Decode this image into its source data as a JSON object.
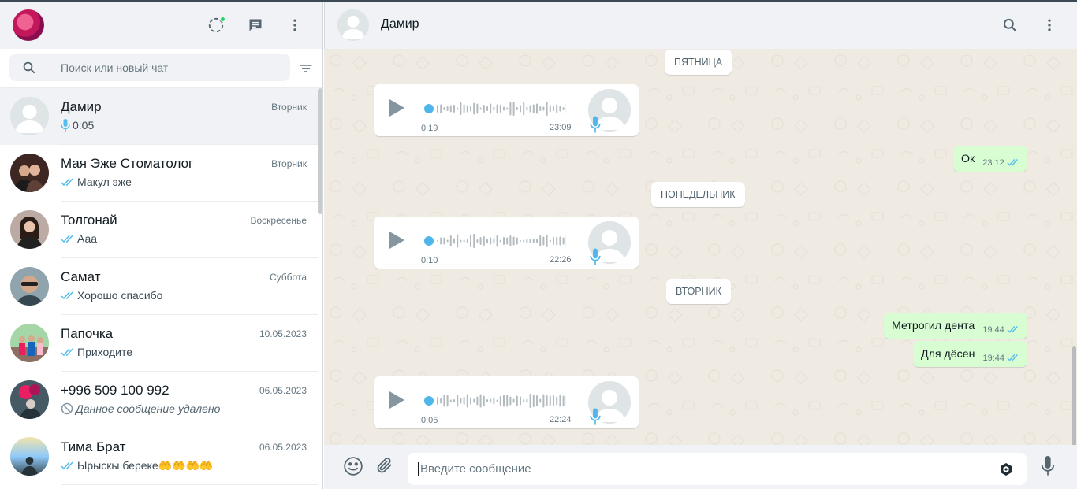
{
  "left_header": {
    "icons": [
      "status-icon",
      "new-chat-icon",
      "menu-icon"
    ]
  },
  "search": {
    "placeholder": "Поиск или новый чат"
  },
  "chats": [
    {
      "name": "Дамир",
      "time": "Вторник",
      "preview": "0:05",
      "preview_type": "voice",
      "active": true
    },
    {
      "name": "Мая Эже Стоматолог",
      "time": "Вторник",
      "preview": "Макул эже",
      "preview_type": "read"
    },
    {
      "name": "Толгонай",
      "time": "Воскресенье",
      "preview": "Ааа",
      "preview_type": "read"
    },
    {
      "name": "Самат",
      "time": "Суббота",
      "preview": "Хорошо спасибо",
      "preview_type": "read"
    },
    {
      "name": "Папочка",
      "time": "10.05.2023",
      "preview": "Приходите",
      "preview_type": "read"
    },
    {
      "name": "+996 509 100 992",
      "time": "06.05.2023",
      "preview": "Данное сообщение удалено",
      "preview_type": "deleted"
    },
    {
      "name": "Тима Брат",
      "time": "06.05.2023",
      "preview": "Ырыскы береке🤲🤲🤲🤲",
      "preview_type": "read"
    }
  ],
  "conversation": {
    "title": "Дамир",
    "dates": [
      "ПЯТНИЦА",
      "ПОНЕДЕЛЬНИК",
      "ВТОРНИК"
    ],
    "voice_messages": [
      {
        "duration": "0:19",
        "time": "23:09"
      },
      {
        "duration": "0:10",
        "time": "22:26"
      },
      {
        "duration": "0:05",
        "time": "22:24"
      }
    ],
    "outgoing": [
      {
        "text": "Ок",
        "time": "23:12"
      },
      {
        "text": "Метрогил дента",
        "time": "19:44"
      },
      {
        "text": "Для дёсен",
        "time": "19:44"
      }
    ]
  },
  "composer": {
    "placeholder": "Введите сообщение"
  },
  "colors": {
    "header_bg": "#f0f2f5",
    "chat_bg": "#efeae2",
    "outgoing_bubble": "#d9fdd3",
    "read_ticks": "#53bdeb",
    "status_dot": "#25d366"
  }
}
